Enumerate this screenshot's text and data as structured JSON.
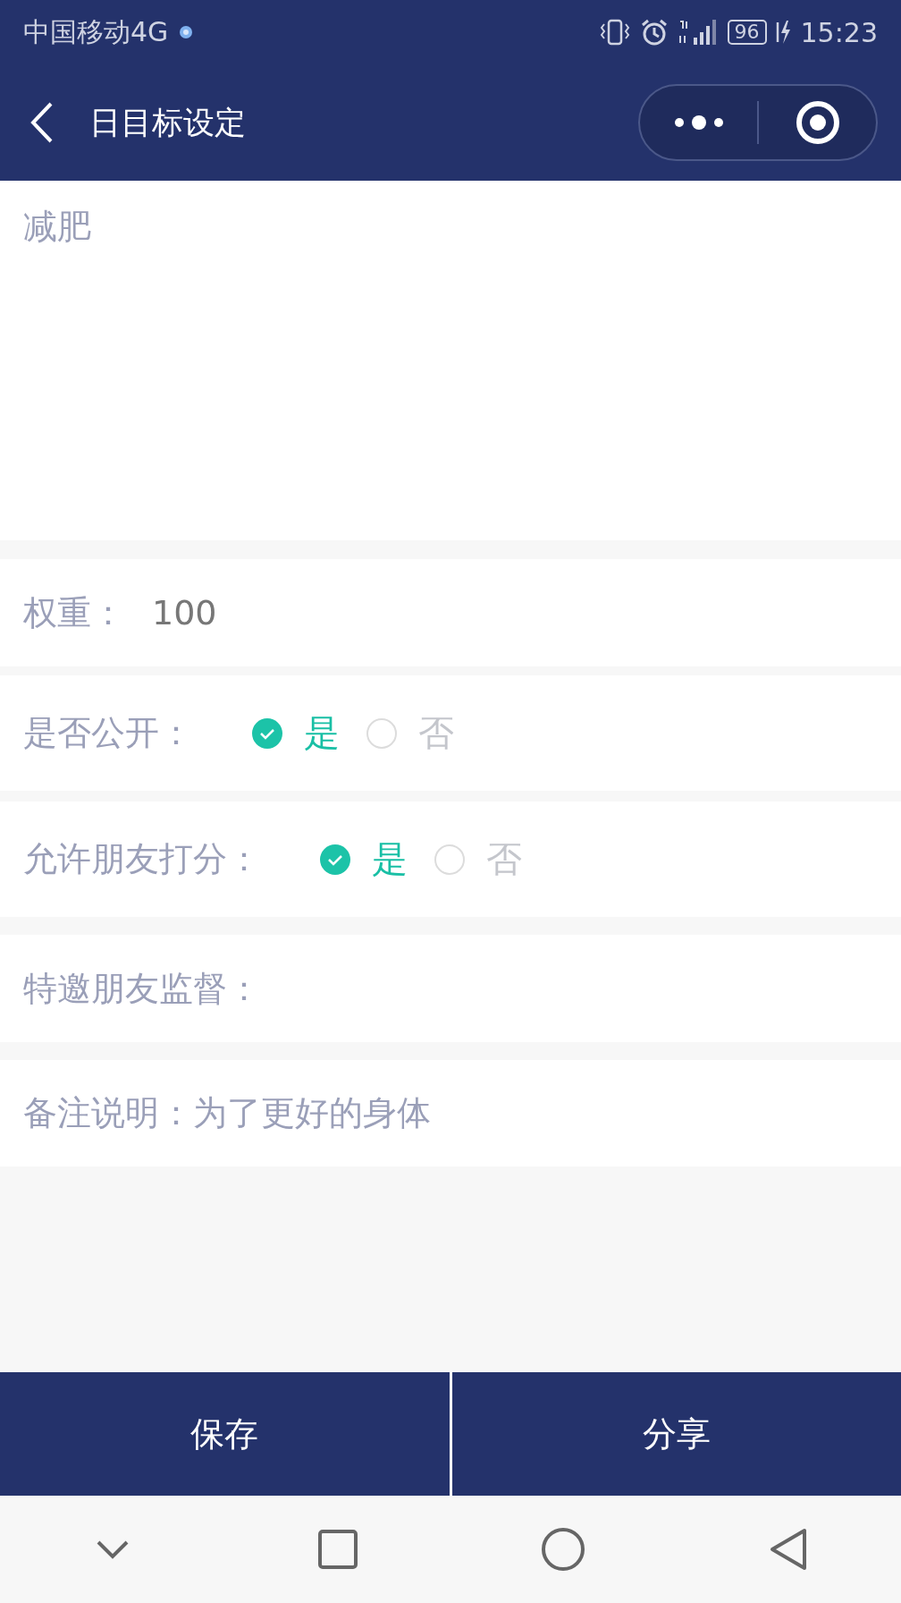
{
  "status_bar": {
    "carrier": "中国移动4G",
    "battery": "96",
    "time": "15:23"
  },
  "nav": {
    "title": "日目标设定"
  },
  "goal": {
    "value": "减肥"
  },
  "weight": {
    "label": "权重：",
    "value": "100"
  },
  "toggles": [
    {
      "label": "是否公开：",
      "options": [
        {
          "label": "是",
          "selected": true
        },
        {
          "label": "否",
          "selected": false
        }
      ]
    },
    {
      "label": "允许朋友打分：",
      "options": [
        {
          "label": "是",
          "selected": true
        },
        {
          "label": "否",
          "selected": false
        }
      ]
    }
  ],
  "supervisors": {
    "label": "特邀朋友监督："
  },
  "note": {
    "label": "备注说明：",
    "value": "为了更好的身体"
  },
  "buttons": [
    "保存",
    "分享"
  ]
}
